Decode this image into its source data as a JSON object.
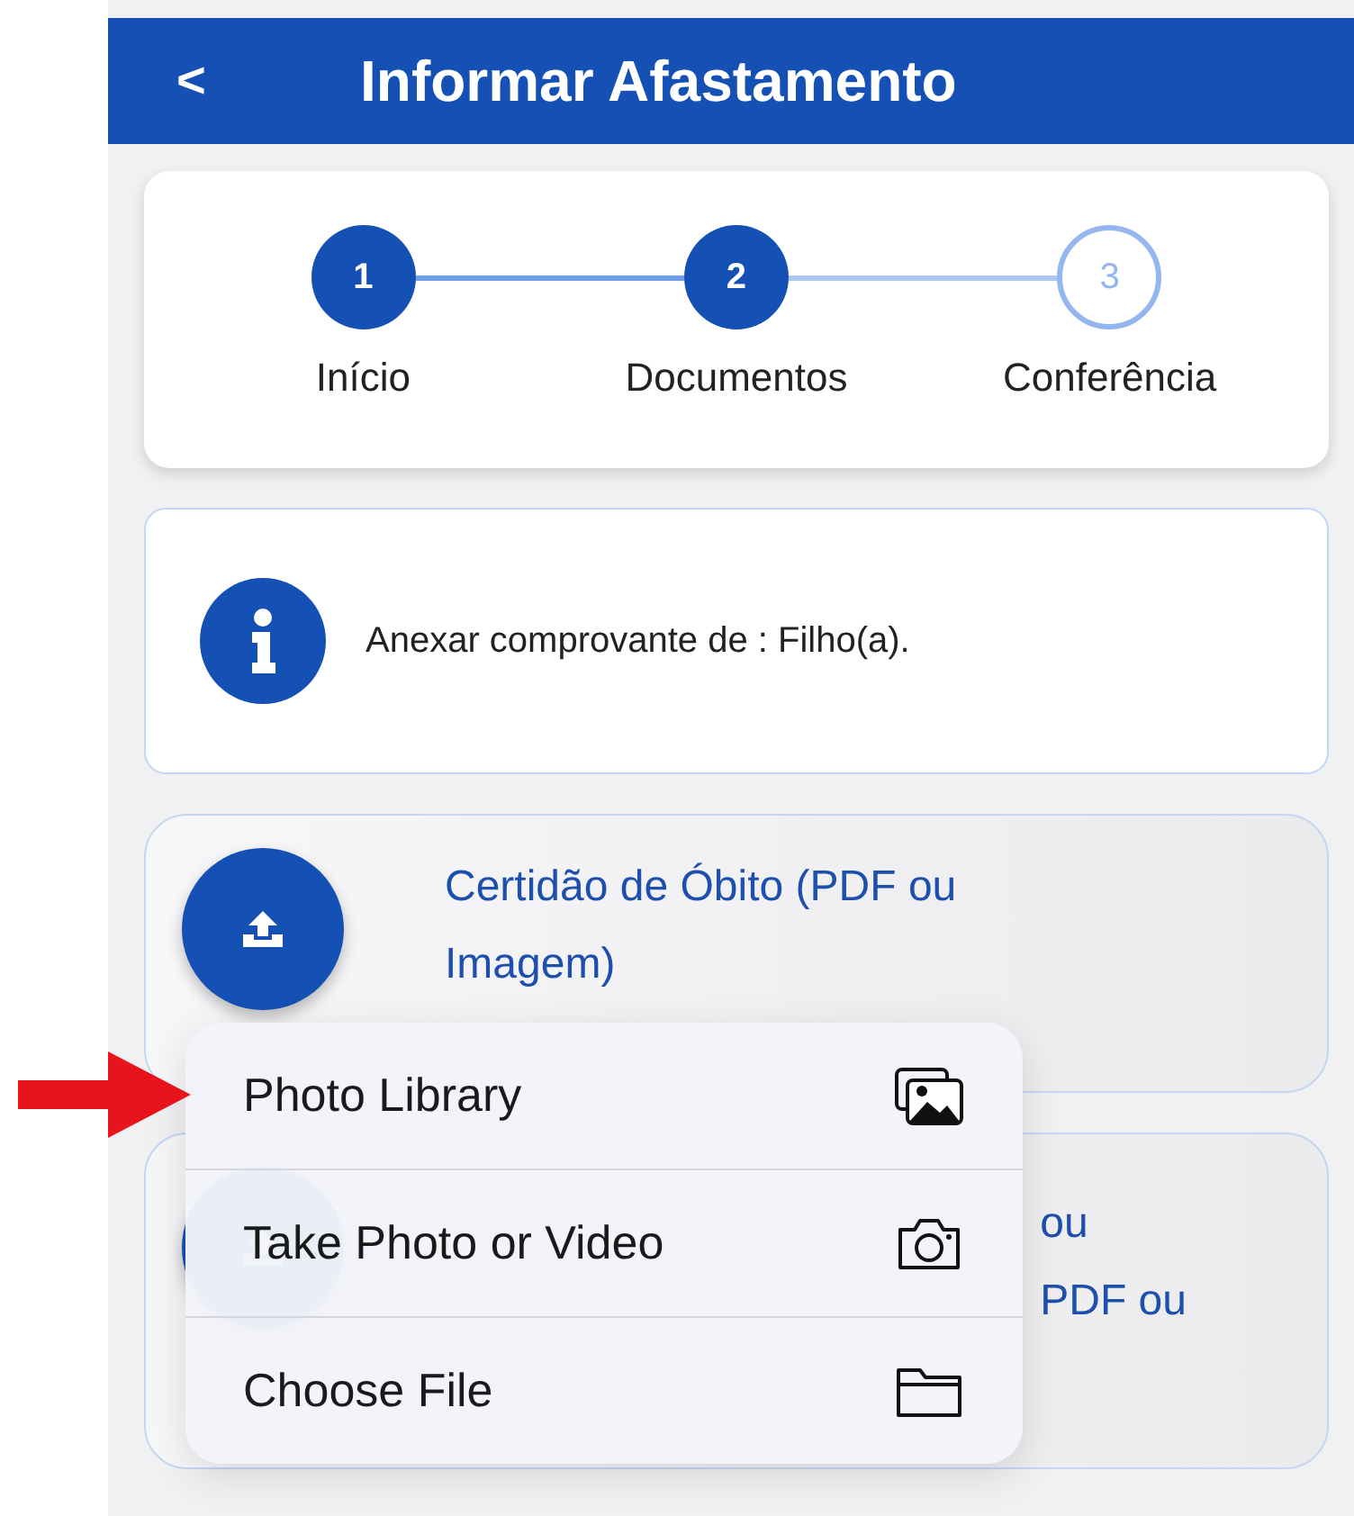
{
  "header": {
    "back": "<",
    "title": "Informar Afastamento"
  },
  "steps": [
    {
      "number": "1",
      "label": "Início",
      "completed": true
    },
    {
      "number": "2",
      "label": "Documentos",
      "completed": true
    },
    {
      "number": "3",
      "label": "Conferência",
      "completed": false
    }
  ],
  "info": {
    "text": "Anexar comprovante de : Filho(a)."
  },
  "uploads": [
    {
      "lines": [
        "Certidão de Óbito (PDF ou",
        "Imagem)"
      ]
    },
    {
      "lines": [
        "ou",
        "PDF ou"
      ]
    }
  ],
  "menu": [
    {
      "label": "Photo Library",
      "kind": "photos"
    },
    {
      "label": "Take Photo or Video",
      "kind": "camera"
    },
    {
      "label": "Choose File",
      "kind": "folder"
    }
  ]
}
